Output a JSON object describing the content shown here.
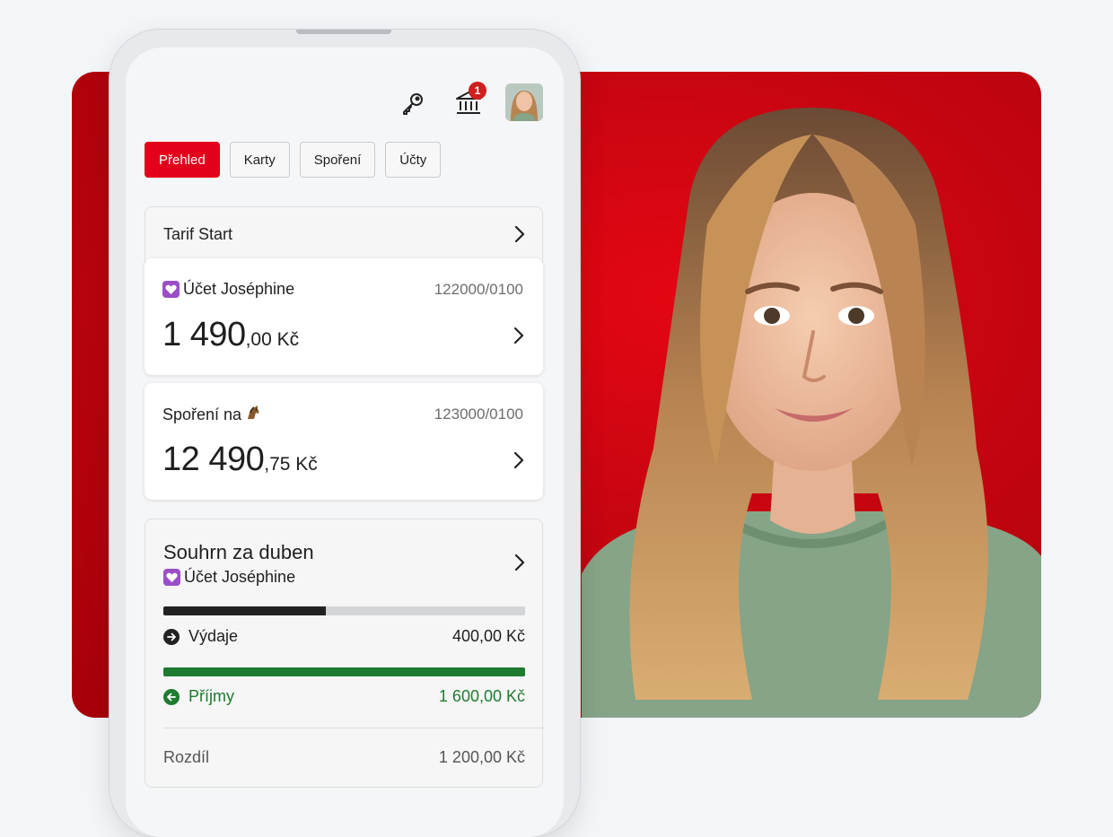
{
  "colors": {
    "brand_red": "#e2001a",
    "income_green": "#1e7b2f",
    "expense_dark": "#222222"
  },
  "header": {
    "key_icon": "key-icon",
    "bank_icon": "bank-icon",
    "notification_count": "1"
  },
  "tabs": [
    {
      "label": "Přehled",
      "active": true
    },
    {
      "label": "Karty",
      "active": false
    },
    {
      "label": "Spoření",
      "active": false
    },
    {
      "label": "Účty",
      "active": false
    }
  ],
  "tarif": {
    "title": "Tarif Start"
  },
  "accounts": [
    {
      "name": "Účet Joséphine",
      "number": "122000/0100",
      "amount_main": "1 490",
      "amount_dec": ",00 Kč",
      "icon": "heart-icon"
    },
    {
      "name": "Spoření na",
      "number": "123000/0100",
      "amount_main": "12 490",
      "amount_dec": ",75 Kč",
      "icon": "horse-icon"
    }
  ],
  "summary": {
    "title": "Souhrn za duben",
    "account": "Účet Joséphine",
    "expenses": {
      "label": "Výdaje",
      "value": "400,00 Kč",
      "fraction": 0.45
    },
    "income": {
      "label": "Příjmy",
      "value": "1 600,00 Kč",
      "fraction": 1.0
    },
    "difference": {
      "label": "Rozdíl",
      "value": "1 200,00 Kč"
    }
  }
}
